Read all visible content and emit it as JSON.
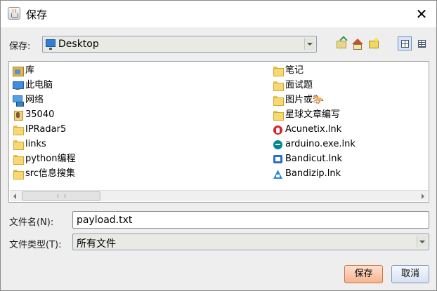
{
  "window": {
    "title": "保存",
    "close_glyph": "✕"
  },
  "save_in": {
    "label": "保存:",
    "location": "Desktop"
  },
  "files": [
    {
      "name": "库",
      "icon": "library-folder-icon"
    },
    {
      "name": "此电脑",
      "icon": "computer-icon"
    },
    {
      "name": "网络",
      "icon": "network-icon"
    },
    {
      "name": "35040",
      "icon": "user-folder-icon"
    },
    {
      "name": "IPRadar5",
      "icon": "folder-icon"
    },
    {
      "name": "links",
      "icon": "folder-icon"
    },
    {
      "name": "python编程",
      "icon": "folder-icon"
    },
    {
      "name": "src信息搜集",
      "icon": "folder-icon"
    },
    {
      "name": "笔记",
      "icon": "folder-icon"
    },
    {
      "name": "面试题",
      "icon": "folder-icon"
    },
    {
      "name": "图片或🐎",
      "icon": "folder-icon"
    },
    {
      "name": "星球文章编写",
      "icon": "folder-icon"
    },
    {
      "name": "Acunetix.lnk",
      "icon": "acunetix-shortcut-icon"
    },
    {
      "name": "arduino.exe.lnk",
      "icon": "arduino-shortcut-icon"
    },
    {
      "name": "Bandicut.lnk",
      "icon": "bandicut-shortcut-icon"
    },
    {
      "name": "Bandizip.lnk",
      "icon": "bandizip-shortcut-icon"
    }
  ],
  "filename": {
    "label": "文件名(N):",
    "value": "payload.txt"
  },
  "filetype": {
    "label": "文件类型(T):",
    "value": "所有文件"
  },
  "buttons": {
    "save": "保存",
    "cancel": "取消"
  },
  "colors": {
    "save_button": "#f6b38f",
    "cancel_button": "#d6e1f1",
    "selection_accent": "#6d8fbf"
  }
}
